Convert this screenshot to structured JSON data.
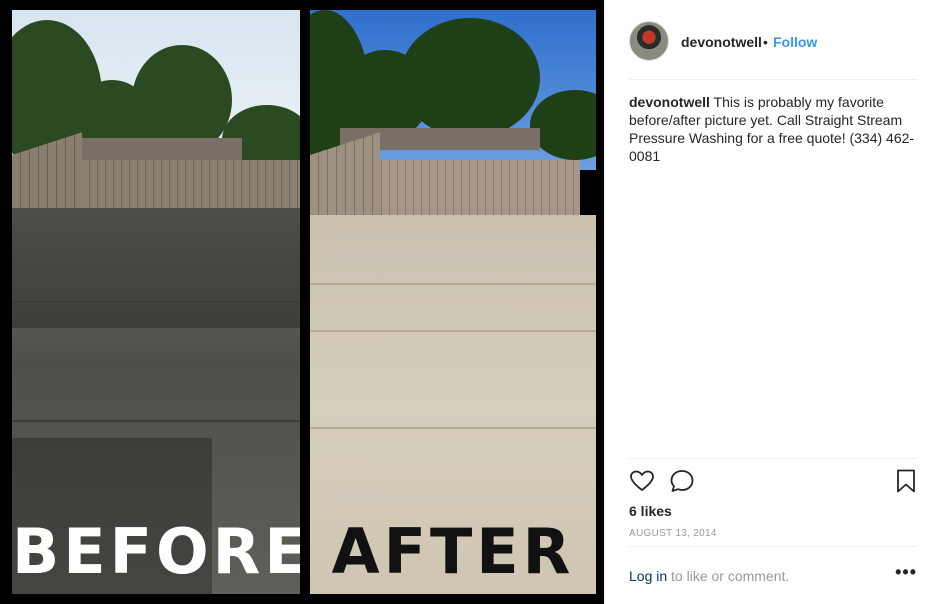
{
  "photo": {
    "left_label": "BEFORE",
    "right_label": "AFTER"
  },
  "post": {
    "username": "devonotwell",
    "separator": "•",
    "follow_label": "Follow",
    "caption_user": "devonotwell",
    "caption_text": "This is probably my favorite before/after picture yet. Call Straight Stream Pressure Washing for a free quote! (334) 462-0081",
    "likes": "6 likes",
    "date": "AUGUST 13, 2014",
    "login_link": "Log in",
    "login_suffix": " to like or comment.",
    "more_label": "•••"
  },
  "icons": {
    "like": "heart-icon",
    "comment": "comment-icon",
    "save": "bookmark-icon",
    "more": "more-options-icon"
  },
  "colors": {
    "link_blue": "#3897f0",
    "login_blue": "#003569",
    "text": "#262626",
    "muted": "#999999"
  }
}
